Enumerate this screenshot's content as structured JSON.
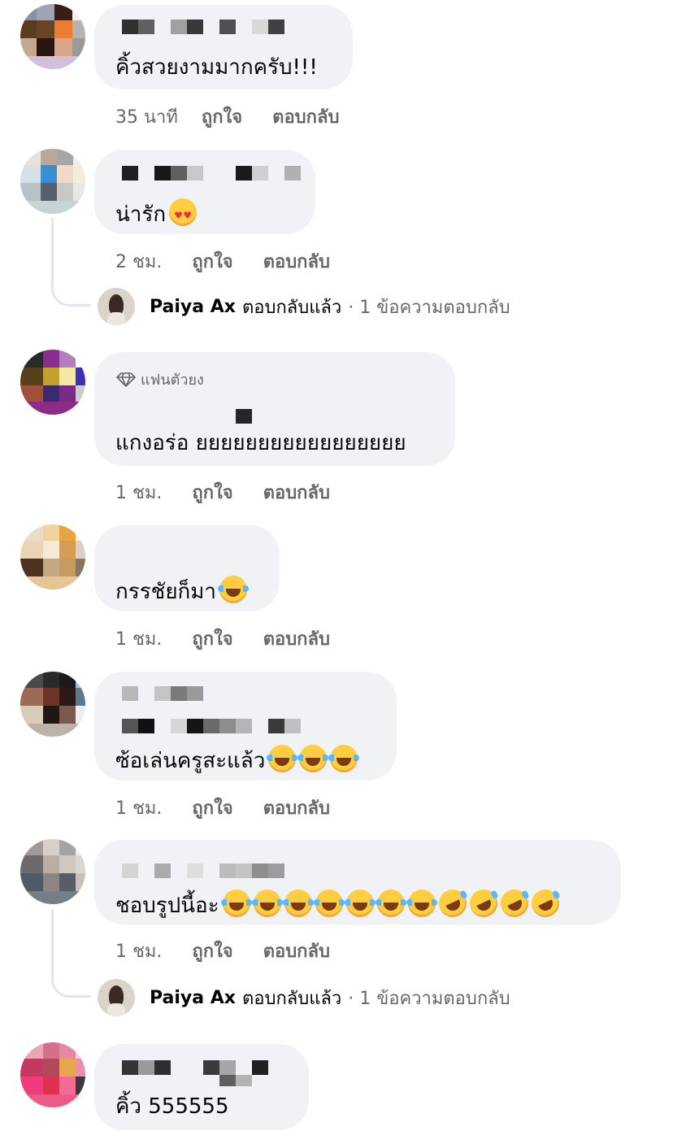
{
  "actions": {
    "like": "ถูกใจ",
    "reply": "ตอบกลับ"
  },
  "comments": [
    {
      "text": "คิ้วสวยงามมากครับ!!!",
      "time": "35 นาที"
    },
    {
      "text": "น่ารัก",
      "time": "2 ชม.",
      "emojis": [
        "smiling-face-with-heart-eyes"
      ]
    },
    {
      "badge": "แฟนตัวยง",
      "text": "แกงอร่อ ยยยยยยยยยยยยยยยยย",
      "time": "1 ชม."
    },
    {
      "text": "กรรชัยก็มา",
      "time": "1 ชม.",
      "emojis": [
        "face-with-tears-of-joy"
      ]
    },
    {
      "text": "ซ้อเล่นครูสะแล้ว",
      "time": "1 ชม.",
      "emojis": [
        "face-with-tears-of-joy",
        "face-with-tears-of-joy",
        "face-with-tears-of-joy"
      ]
    },
    {
      "text": "ชอบรูปนี้อะ",
      "time": "1 ชม.",
      "emojis": [
        "face-with-tears-of-joy",
        "face-with-tears-of-joy",
        "face-with-tears-of-joy",
        "face-with-tears-of-joy",
        "face-with-tears-of-joy",
        "face-with-tears-of-joy",
        "face-with-tears-of-joy",
        "rolling-on-the-floor-laughing",
        "rolling-on-the-floor-laughing",
        "rolling-on-the-floor-laughing",
        "rolling-on-the-floor-laughing"
      ]
    },
    {
      "text": "คิ้ว 555555"
    }
  ],
  "replies": [
    {
      "name": "Paiya Ax",
      "verb": "ตอบกลับแล้ว",
      "count": "· 1 ข้อความตอบกลับ"
    },
    {
      "name": "Paiya Ax",
      "verb": "ตอบกลับแล้ว",
      "count": "· 1 ข้อความตอบกลับ"
    }
  ],
  "colors": {
    "bubble": "#f0f2f5",
    "meta_text": "#65676b",
    "thread_line": "#e4e6eb"
  }
}
